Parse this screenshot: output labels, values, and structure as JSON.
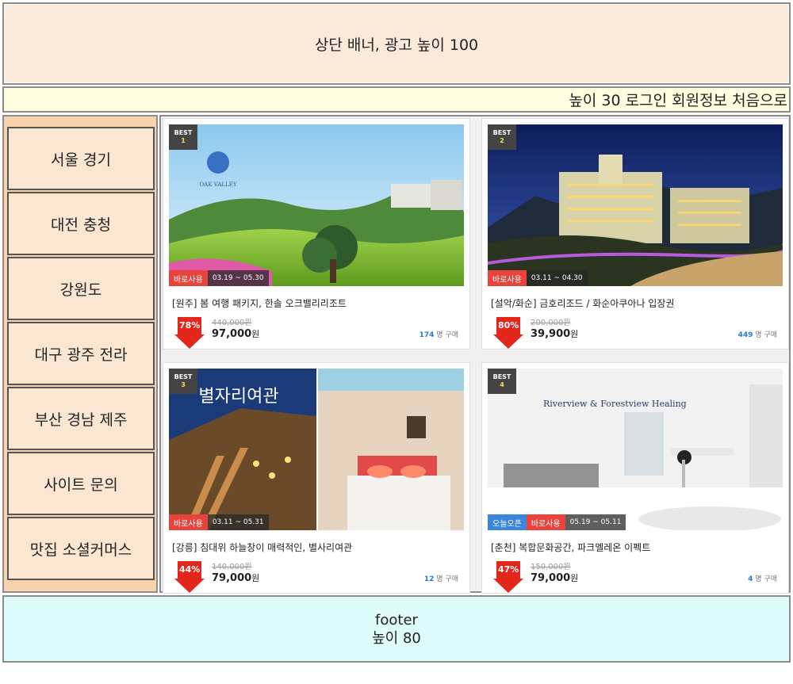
{
  "banner": {
    "text": "상단 배너, 광고 높이 100"
  },
  "login_bar": {
    "text": "높이 30 로그인 회원정보 처음으로"
  },
  "sidebar": {
    "items": [
      {
        "label": "서울 경기"
      },
      {
        "label": "대전 충청"
      },
      {
        "label": "강원도"
      },
      {
        "label": "대구 광주 전라"
      },
      {
        "label": "부산 경남 제주"
      },
      {
        "label": "사이트 문의"
      },
      {
        "label": "맛집 소셜커머스"
      }
    ]
  },
  "products": [
    {
      "best_label": "BEST",
      "rank": "1",
      "tags": [
        "바로사용",
        "03.19 ~ 05.30"
      ],
      "photo_text": "OAK VALLEY",
      "title": "[원주] 봄 여행 패키지, 한솔 오크밸리리조트",
      "discount": "78%",
      "original_price": "440,000원",
      "price": "97,000",
      "won": "원",
      "sold_count": "174",
      "sold_suffix": "명 구매"
    },
    {
      "best_label": "BEST",
      "rank": "2",
      "tags": [
        "바로사용",
        "03.11 ~ 04.30"
      ],
      "photo_text": "",
      "title": "[설악/화순] 금호리조드 / 화순아쿠아나 입장권",
      "discount": "80%",
      "original_price": "200,000원",
      "price": "39,900",
      "won": "원",
      "sold_count": "449",
      "sold_suffix": "명 구매"
    },
    {
      "best_label": "BEST",
      "rank": "3",
      "tags": [
        "바로사용",
        "03.11 ~ 05.31"
      ],
      "photo_text": "별자리여관",
      "title": "[강릉] 침대위 하늘창이 매력적인, 별사리여관",
      "discount": "44%",
      "original_price": "140,000원",
      "price": "79,000",
      "won": "원",
      "sold_count": "12",
      "sold_suffix": "명 구매"
    },
    {
      "best_label": "BEST",
      "rank": "4",
      "tags": [
        "오늘오픈",
        "바로사용",
        "05.19 ~ 05.11"
      ],
      "photo_text": "Riverview & Forestview Healing",
      "title": "[춘천] 복합문화공간, 파크멜레온 이펙트",
      "discount": "47%",
      "original_price": "150,000원",
      "price": "79,000",
      "won": "원",
      "sold_count": "4",
      "sold_suffix": "명 구매"
    }
  ],
  "footer": {
    "line1": "footer",
    "line2": "높이 80"
  },
  "colors": {
    "banner_bg": "#fbe9d9",
    "login_bg": "#fffde0",
    "sidebar_bg": "#f7d2ad",
    "footer_bg": "#dffcfc",
    "discount_red": "#e2261c",
    "sold_blue": "#2a7ad4"
  }
}
